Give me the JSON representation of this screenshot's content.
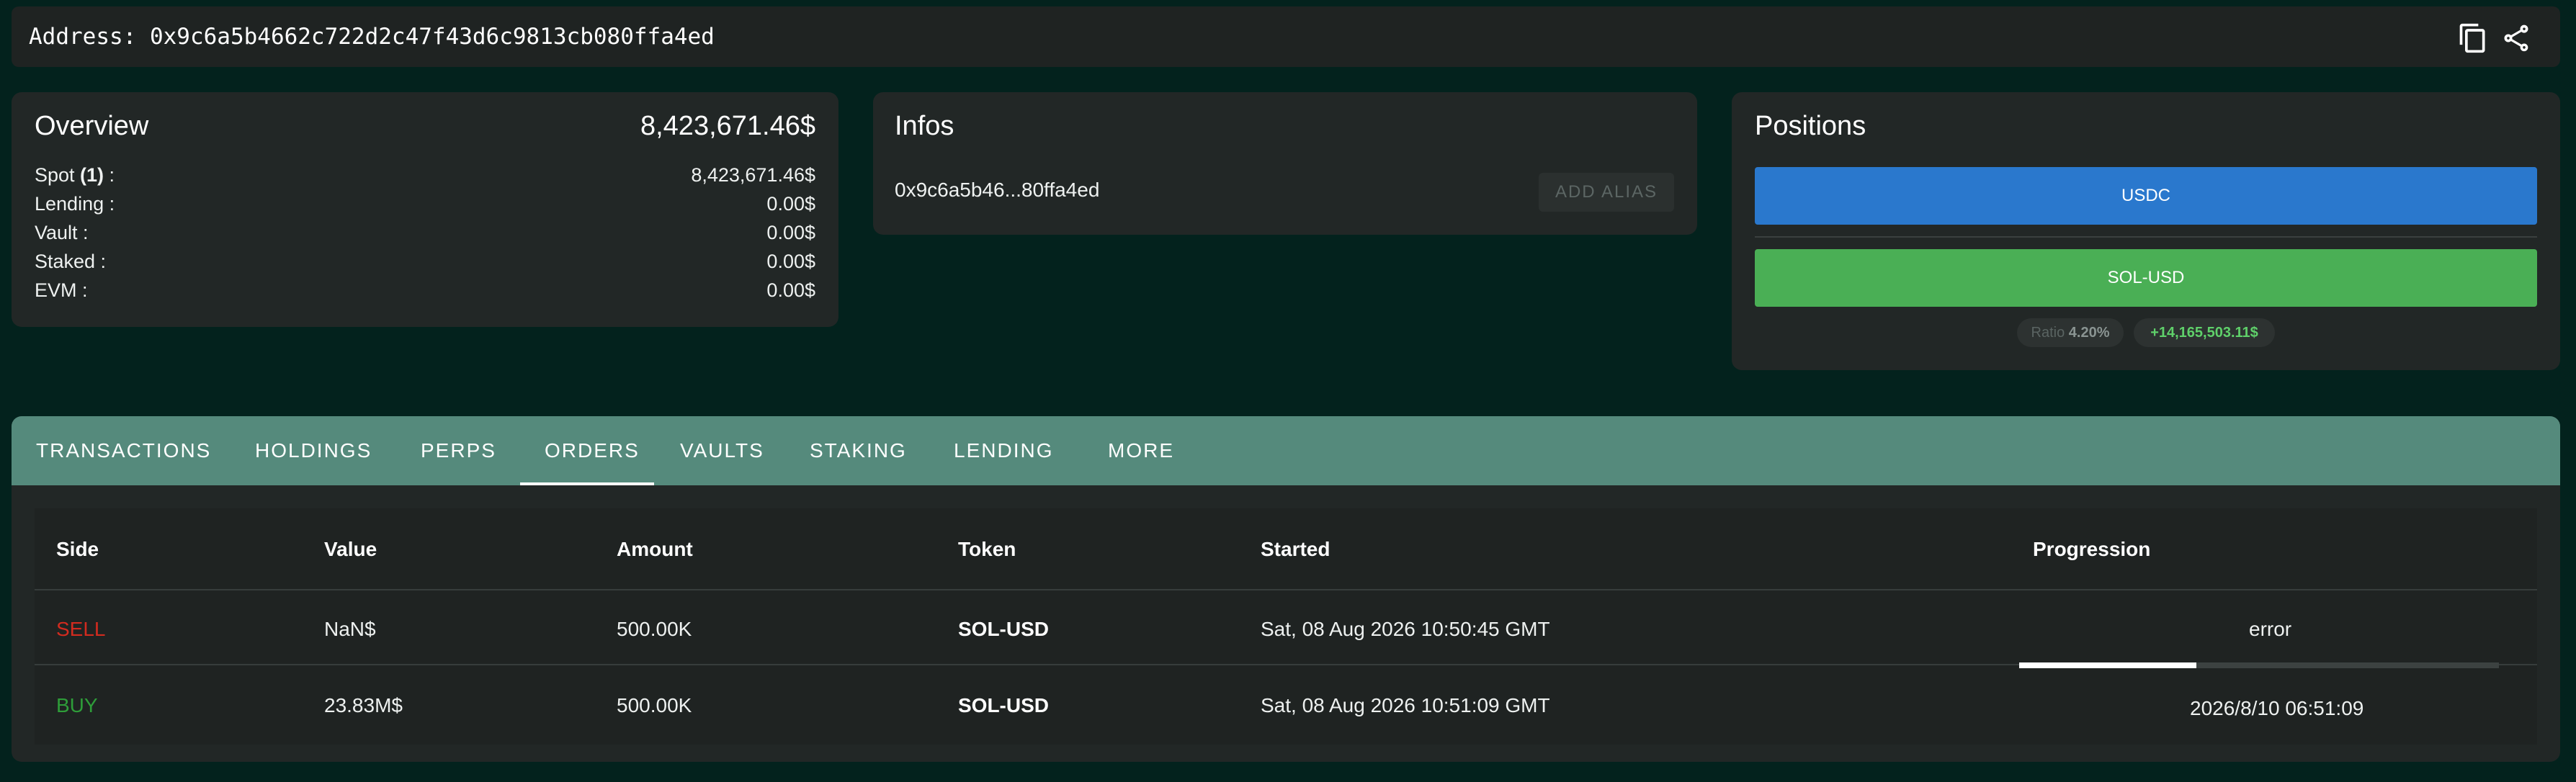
{
  "address_bar": {
    "label": "Address: 0x9c6a5b4662c722d2c47f43d6c9813cb080ffa4ed",
    "copy_icon": "copy-icon",
    "share_icon": "share-icon"
  },
  "overview": {
    "title": "Overview",
    "total": "8,423,671.46$",
    "rows": [
      {
        "label": "Spot ",
        "badge": "(1)",
        "suffix": " :",
        "value": "8,423,671.46$"
      },
      {
        "label": "Lending :",
        "value": "0.00$"
      },
      {
        "label": "Vault :",
        "value": "0.00$"
      },
      {
        "label": "Staked :",
        "value": "0.00$"
      },
      {
        "label": "EVM :",
        "value": "0.00$"
      }
    ]
  },
  "infos": {
    "title": "Infos",
    "short_address": "0x9c6a5b46...80ffa4ed",
    "add_alias_label": "ADD ALIAS"
  },
  "positions": {
    "title": "Positions",
    "bars": [
      {
        "label": "USDC",
        "color": "#2a78cd"
      },
      {
        "label": "SOL-USD",
        "color": "#4aaf55"
      }
    ],
    "ratio_label": "Ratio",
    "ratio_value": "4.20%",
    "pnl": "+14,165,503.11$"
  },
  "tabs": {
    "items": [
      "TRANSACTIONS",
      "HOLDINGS",
      "PERPS",
      "ORDERS",
      "VAULTS",
      "STAKING",
      "LENDING",
      "MORE"
    ],
    "active": "ORDERS"
  },
  "orders_table": {
    "columns": [
      "Side",
      "Value",
      "Amount",
      "Token",
      "Started",
      "Progression"
    ],
    "rows": [
      {
        "side": "SELL",
        "value": "NaN$",
        "amount": "500.00K",
        "token": "SOL-USD",
        "started": "Sat, 08 Aug 2026 10:50:45 GMT",
        "progression": "error"
      },
      {
        "side": "BUY",
        "value": "23.83M$",
        "amount": "500.00K",
        "token": "SOL-USD",
        "started": "Sat, 08 Aug 2026 10:51:09 GMT",
        "progression": "2026/8/10 06:51:09",
        "progress_fraction": 0.37
      }
    ]
  },
  "colors": {
    "background": "#03221d",
    "tab_bar": "#558a7c",
    "sell": "#d22b1f",
    "buy": "#2e9d39",
    "pnl": "#5fd06a"
  }
}
